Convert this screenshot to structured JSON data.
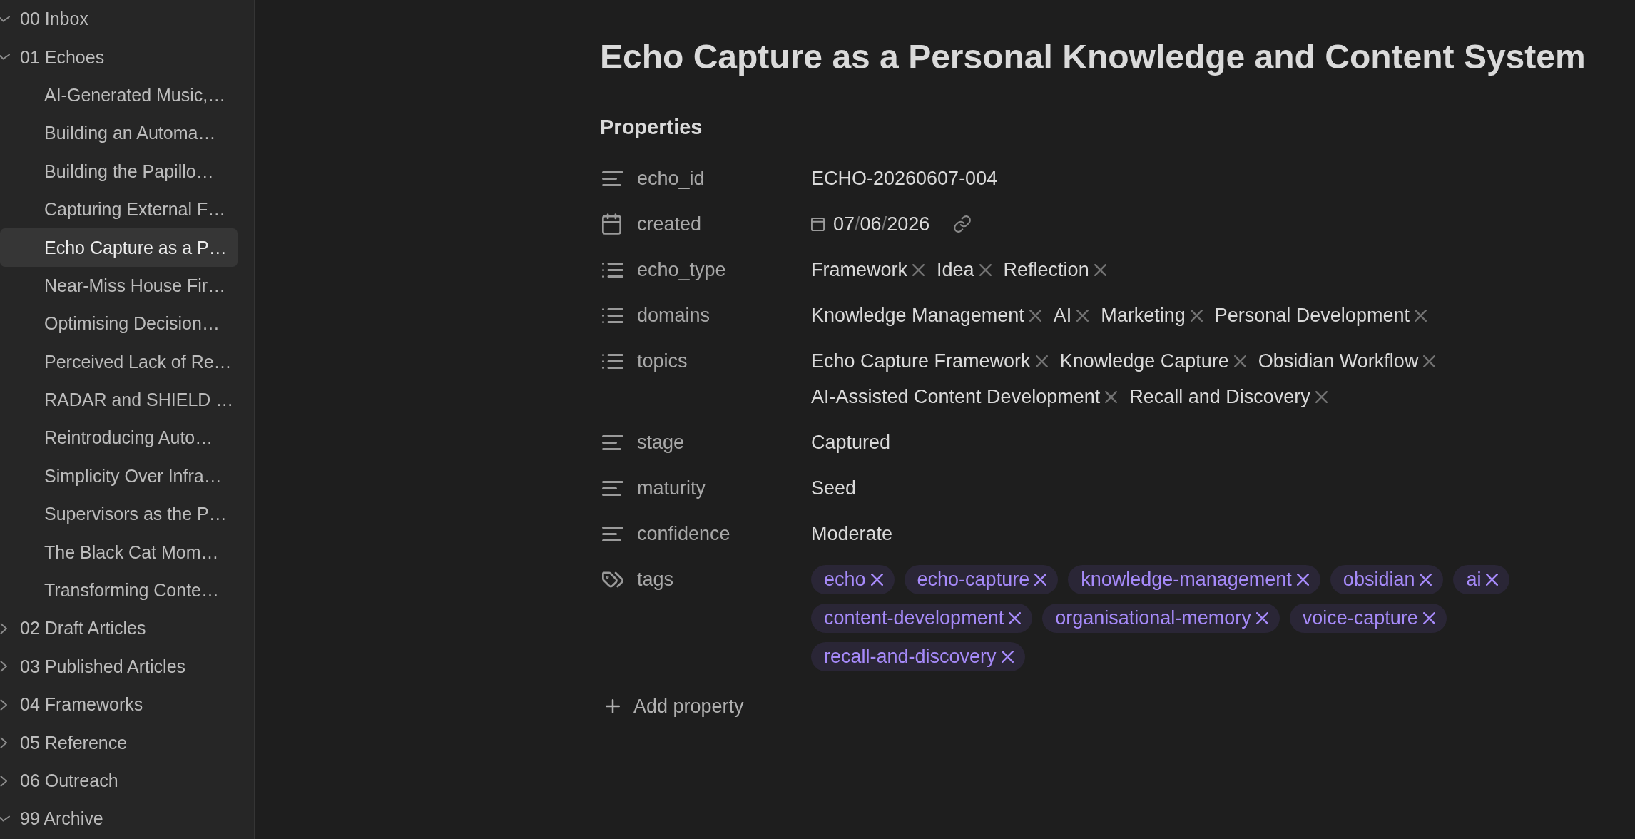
{
  "sidebar": {
    "folders": [
      {
        "label": "00 Inbox",
        "expanded": true
      },
      {
        "label": "01 Echoes",
        "expanded": true,
        "children": [
          {
            "label": "AI-Generated Music,…",
            "selected": false
          },
          {
            "label": "Building an Automa…",
            "selected": false
          },
          {
            "label": "Building the Papillo…",
            "selected": false
          },
          {
            "label": "Capturing External F…",
            "selected": false
          },
          {
            "label": "Echo Capture as a P…",
            "selected": true
          },
          {
            "label": "Near-Miss House Fir…",
            "selected": false
          },
          {
            "label": "Optimising Decision…",
            "selected": false
          },
          {
            "label": "Perceived Lack of Re…",
            "selected": false
          },
          {
            "label": "RADAR and SHIELD …",
            "selected": false
          },
          {
            "label": "Reintroducing Auto…",
            "selected": false
          },
          {
            "label": "Simplicity Over Infra…",
            "selected": false
          },
          {
            "label": "Supervisors as the P…",
            "selected": false
          },
          {
            "label": "The Black Cat Mom…",
            "selected": false
          },
          {
            "label": "Transforming Conte…",
            "selected": false
          }
        ]
      },
      {
        "label": "02 Draft Articles",
        "expanded": false
      },
      {
        "label": "03 Published Articles",
        "expanded": false
      },
      {
        "label": "04 Frameworks",
        "expanded": false
      },
      {
        "label": "05 Reference",
        "expanded": false
      },
      {
        "label": "06 Outreach",
        "expanded": false
      },
      {
        "label": "99 Archive",
        "expanded": true
      }
    ]
  },
  "note": {
    "title": "Echo Capture as a Personal Knowledge and Content System",
    "properties": {
      "heading": "Properties",
      "items": [
        {
          "kind": "text",
          "name": "echo_id",
          "value": "ECHO-20260607-004"
        },
        {
          "kind": "date",
          "name": "created",
          "value": "07/06/2026"
        },
        {
          "kind": "list",
          "name": "echo_type",
          "values": [
            "Framework",
            "Idea",
            "Reflection"
          ]
        },
        {
          "kind": "list",
          "name": "domains",
          "values": [
            "Knowledge Management",
            "AI",
            "Marketing",
            "Personal Development"
          ]
        },
        {
          "kind": "list",
          "name": "topics",
          "values": [
            "Echo Capture Framework",
            "Knowledge Capture",
            "Obsidian Workflow",
            "AI-Assisted Content Development",
            "Recall and Discovery"
          ]
        },
        {
          "kind": "text",
          "name": "stage",
          "value": "Captured"
        },
        {
          "kind": "text",
          "name": "maturity",
          "value": "Seed"
        },
        {
          "kind": "text",
          "name": "confidence",
          "value": "Moderate"
        },
        {
          "kind": "tags",
          "name": "tags",
          "values": [
            "echo",
            "echo-capture",
            "knowledge-management",
            "obsidian",
            "ai",
            "content-development",
            "organisational-memory",
            "voice-capture",
            "recall-and-discovery"
          ]
        }
      ],
      "add_button": "Add property"
    }
  }
}
